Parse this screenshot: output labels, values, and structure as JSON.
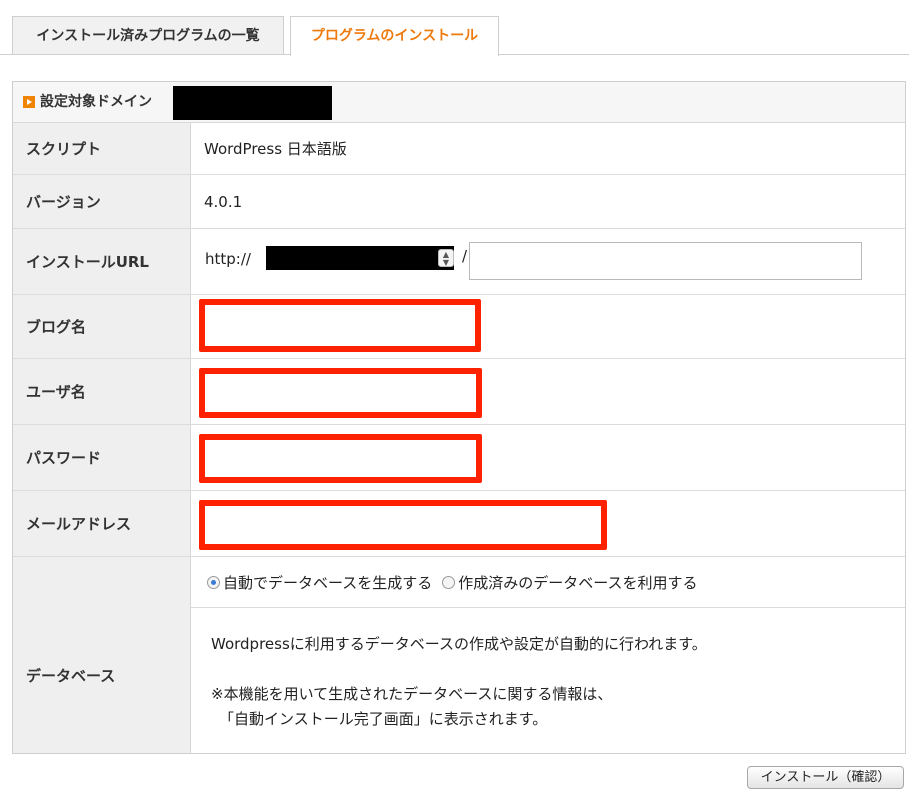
{
  "tabs": {
    "installed_list": "インストール済みプログラムの一覧",
    "install_program": "プログラムのインストール"
  },
  "panel": {
    "header_label": "設定対象ドメイン"
  },
  "rows": {
    "script_label": "スクリプト",
    "script_value": "WordPress 日本語版",
    "version_label": "バージョン",
    "version_value": "4.0.1",
    "url_label": "インストールURL",
    "url_prefix": "http://",
    "url_separator": "/",
    "url_path_value": "",
    "blog_name_label": "ブログ名",
    "blog_name_value": "",
    "user_name_label": "ユーザ名",
    "user_name_value": "",
    "password_label": "パスワード",
    "password_value": "",
    "email_label": "メールアドレス",
    "email_value": "",
    "database_label": "データベース"
  },
  "database": {
    "option_auto": "自動でデータベースを生成する",
    "option_existing": "作成済みのデータベースを利用する",
    "selected": "auto",
    "desc_line1": "Wordpressに利用するデータベースの作成や設定が自動的に行われます。",
    "desc_line2": "※本機能を用いて生成されたデータベースに関する情報は、",
    "desc_line3": "「自動インストール完了画面」に表示されます。"
  },
  "buttons": {
    "confirm": "インストール（確認）"
  },
  "colors": {
    "accent_orange": "#f08300",
    "active_tab_text": "#ee7a0d",
    "highlight_red": "#ff2200"
  }
}
